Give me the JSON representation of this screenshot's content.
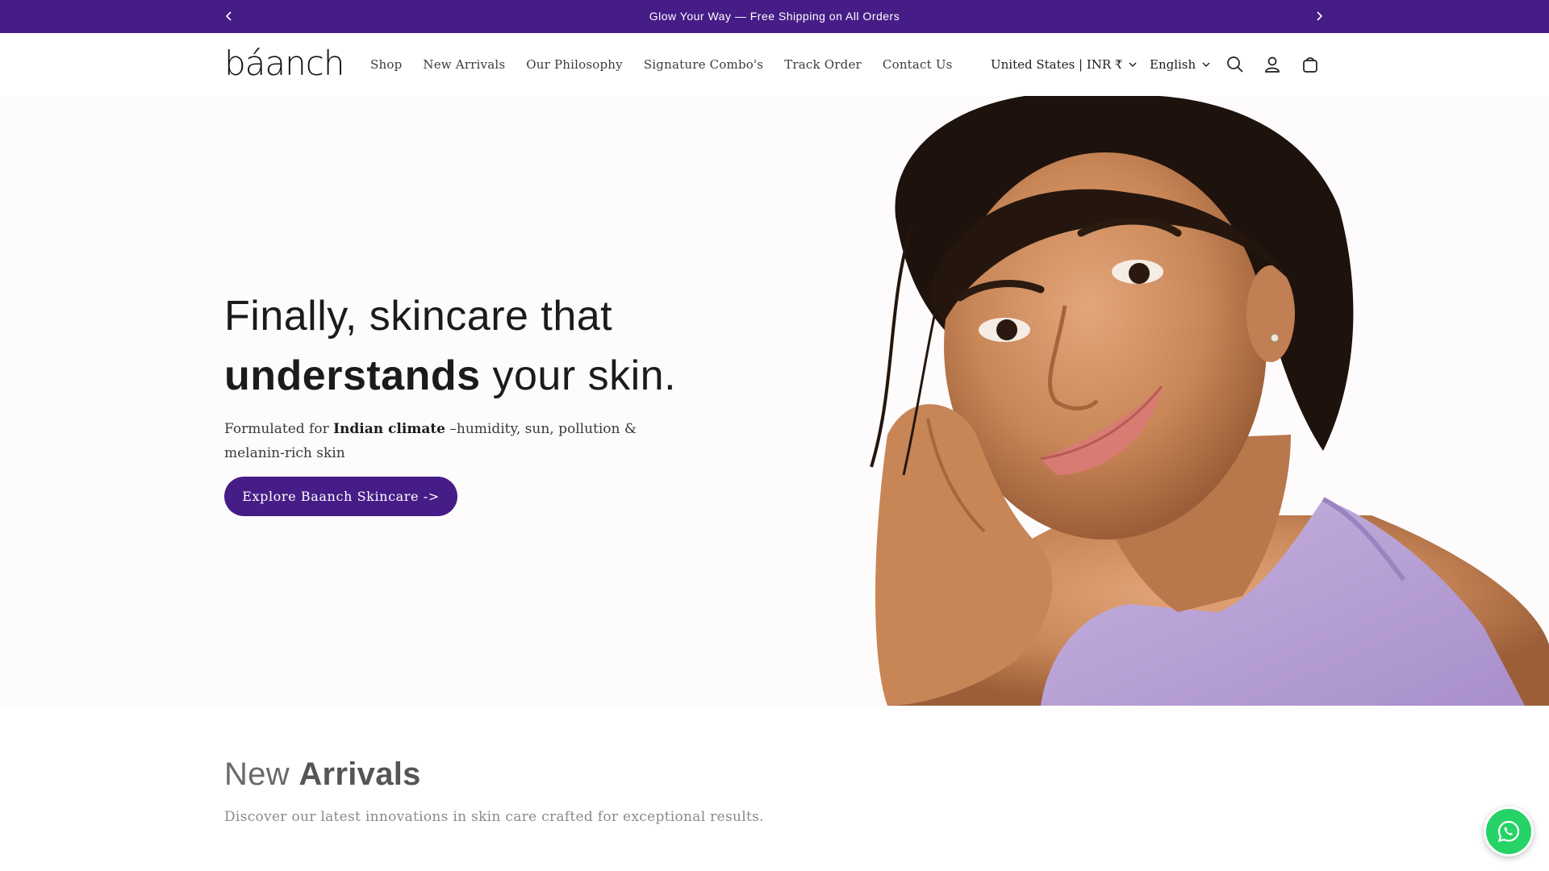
{
  "announcement": {
    "message": "Glow Your Way — Free Shipping on All Orders",
    "prev_icon": "chevron-left-icon",
    "next_icon": "chevron-right-icon",
    "background": "#461d87"
  },
  "header": {
    "logo": "báanch",
    "nav": [
      {
        "label": "Shop"
      },
      {
        "label": "New Arrivals"
      },
      {
        "label": "Our Philosophy"
      },
      {
        "label": "Signature Combo's"
      },
      {
        "label": "Track Order"
      },
      {
        "label": "Contact Us"
      }
    ],
    "country_selector": "United States | INR ₹",
    "language_selector": "English",
    "icons": [
      "search-icon",
      "account-icon",
      "cart-icon"
    ]
  },
  "hero": {
    "title_line1": "Finally, skincare that",
    "title_bold": "understands",
    "title_rest": " your skin.",
    "subtitle_pre": "Formulated for ",
    "subtitle_bold": "Indian climate",
    "subtitle_post": " –humidity, sun, pollution & melanin-rich skin",
    "cta_label": "Explore Baanch Skincare ->"
  },
  "new_arrivals": {
    "heading_light": "New ",
    "heading_bold": "Arrivals",
    "description": "Discover our latest innovations in skin care crafted for exceptional results."
  },
  "whatsapp": {
    "icon": "whatsapp-icon",
    "color": "#25d366"
  },
  "colors": {
    "brand": "#461d87"
  }
}
